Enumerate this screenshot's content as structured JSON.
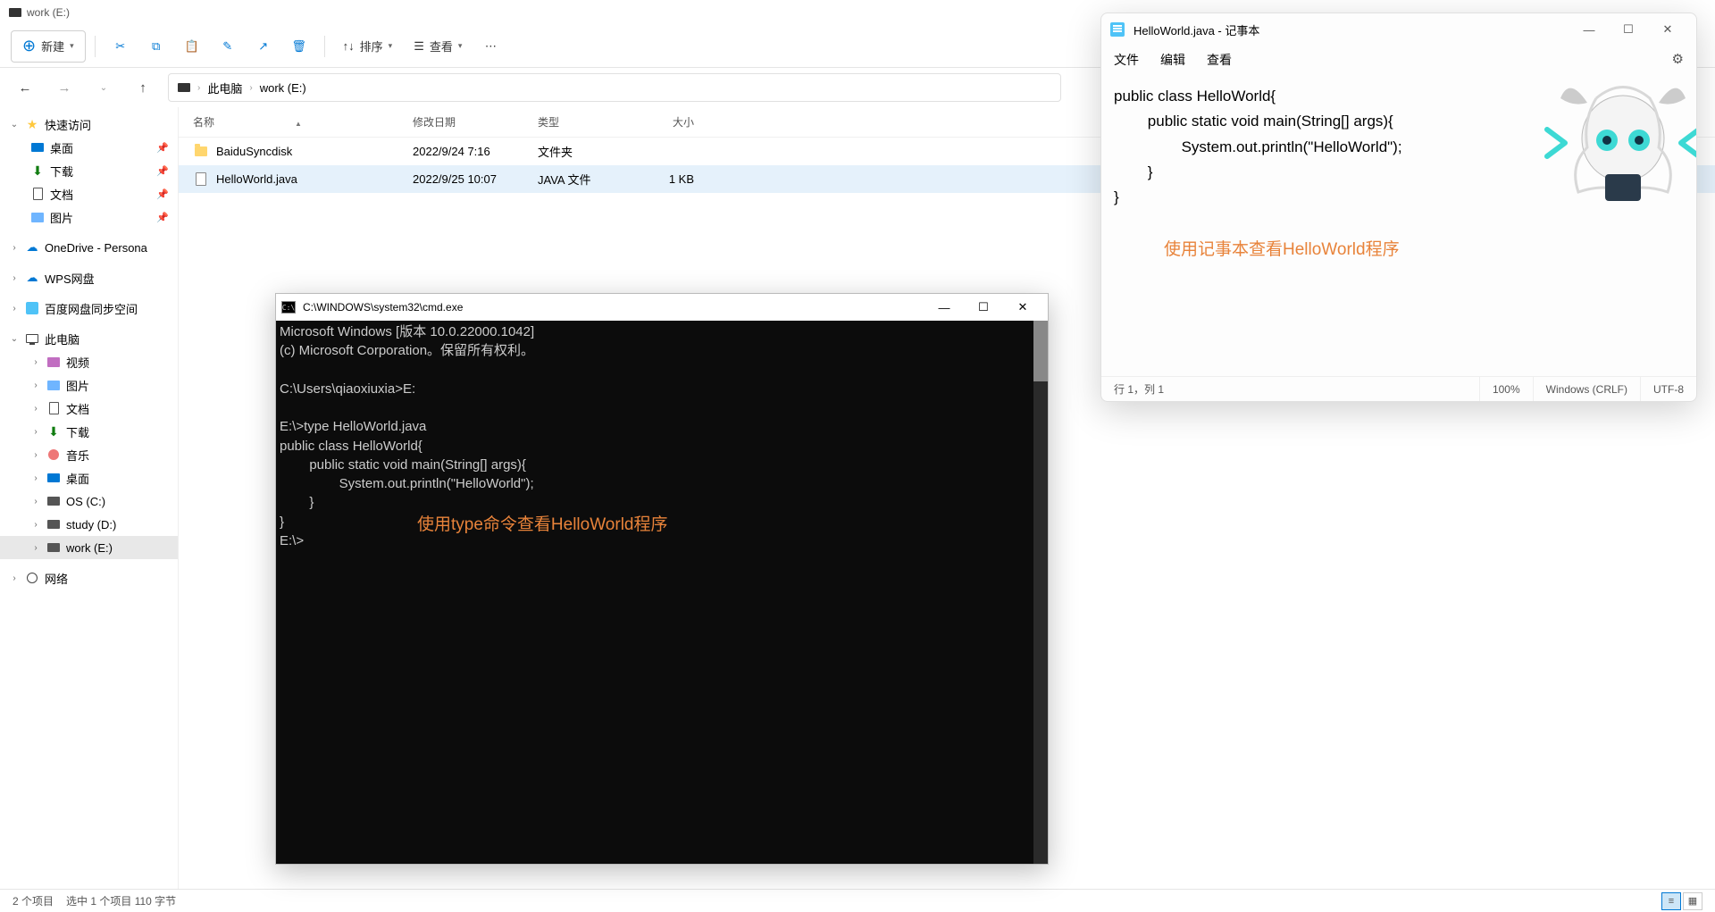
{
  "explorer": {
    "title": "work (E:)",
    "toolbar": {
      "new": "新建",
      "sort": "排序",
      "view": "查看"
    },
    "breadcrumb": [
      "此电脑",
      "work (E:)"
    ],
    "columns": {
      "name": "名称",
      "date": "修改日期",
      "type": "类型",
      "size": "大小"
    },
    "sidebar": {
      "quick": "快速访问",
      "desktop": "桌面",
      "downloads": "下载",
      "documents": "文档",
      "pictures": "图片",
      "onedrive": "OneDrive - Persona",
      "wps": "WPS网盘",
      "baidu": "百度网盘同步空间",
      "thispc": "此电脑",
      "videos": "视频",
      "pictures2": "图片",
      "documents2": "文档",
      "downloads2": "下载",
      "music": "音乐",
      "desktop2": "桌面",
      "osc": "OS (C:)",
      "studyd": "study (D:)",
      "worke": "work (E:)",
      "network": "网络"
    },
    "files": [
      {
        "name": "BaiduSyncdisk",
        "date": "2022/9/24 7:16",
        "type": "文件夹",
        "size": ""
      },
      {
        "name": "HelloWorld.java",
        "date": "2022/9/25 10:07",
        "type": "JAVA 文件",
        "size": "1 KB"
      }
    ],
    "status": {
      "count": "2 个项目",
      "selected": "选中 1 个项目 110 字节"
    }
  },
  "cmd": {
    "title": "C:\\WINDOWS\\system32\\cmd.exe",
    "lines": "Microsoft Windows [版本 10.0.22000.1042]\n(c) Microsoft Corporation。保留所有权利。\n\nC:\\Users\\qiaoxiuxia>E:\n\nE:\\>type HelloWorld.java\npublic class HelloWorld{\n        public static void main(String[] args){\n                System.out.println(\"HelloWorld\");\n        }\n}\nE:\\>",
    "annotation": "使用type命令查看HelloWorld程序"
  },
  "notepad": {
    "title": "HelloWorld.java - 记事本",
    "menu": {
      "file": "文件",
      "edit": "编辑",
      "view": "查看"
    },
    "content": "public class HelloWorld{\n        public static void main(String[] args){\n                System.out.println(\"HelloWorld\");\n        }\n}",
    "annotation": "使用记事本查看HelloWorld程序",
    "status": {
      "pos": "行 1，列 1",
      "zoom": "100%",
      "eol": "Windows (CRLF)",
      "enc": "UTF-8"
    }
  }
}
